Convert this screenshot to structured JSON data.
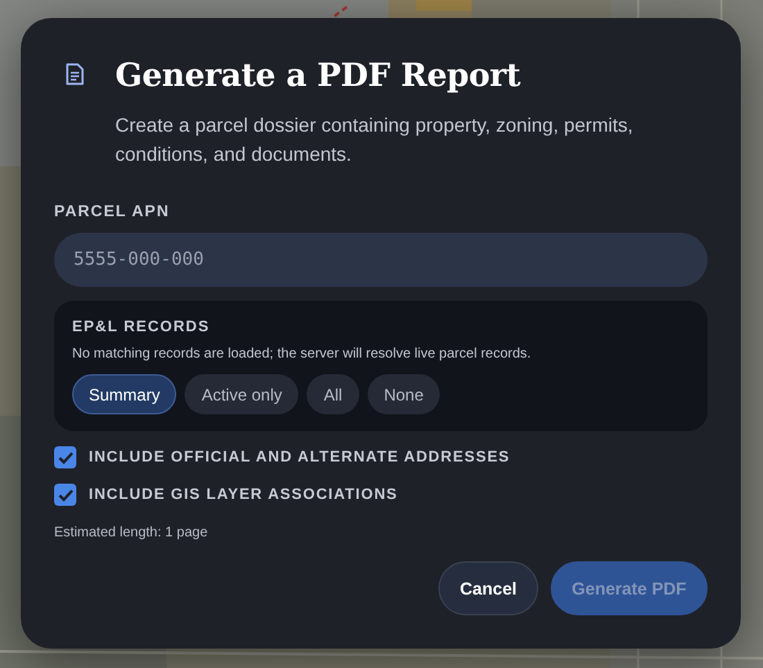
{
  "dialog": {
    "title": "Generate a PDF Report",
    "description": "Create a parcel dossier containing property, zoning, permits, conditions, and documents."
  },
  "parcel_apn": {
    "label": "PARCEL APN",
    "placeholder": "5555-000-000"
  },
  "records": {
    "title": "EP&L RECORDS",
    "note": "No matching records are loaded; the server will resolve live parcel records.",
    "options": [
      {
        "label": "Summary",
        "selected": true
      },
      {
        "label": "Active only",
        "selected": false
      },
      {
        "label": "All",
        "selected": false
      },
      {
        "label": "None",
        "selected": false
      }
    ]
  },
  "checkboxes": [
    {
      "label": "INCLUDE OFFICIAL AND ALTERNATE ADDRESSES",
      "checked": true
    },
    {
      "label": "INCLUDE GIS LAYER ASSOCIATIONS",
      "checked": true
    }
  ],
  "estimate": "Estimated length: 1 page",
  "buttons": [
    {
      "label": "Cancel",
      "kind": "secondary",
      "disabled": false
    },
    {
      "label": "Generate PDF",
      "kind": "primary",
      "disabled": true
    }
  ]
}
